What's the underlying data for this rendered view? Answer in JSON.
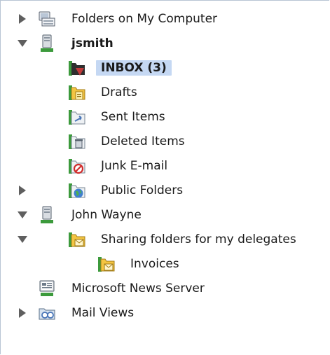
{
  "window": {
    "title": ""
  },
  "tree": {
    "folders_on_computer": "Folders on My Computer",
    "account_jsmith": "jsmith",
    "inbox": "INBOX (3)",
    "drafts": "Drafts",
    "sent": "Sent Items",
    "deleted": "Deleted Items",
    "junk": "Junk E-mail",
    "public": "Public Folders",
    "account_john": "John Wayne",
    "sharing": "Sharing folders for my delegates",
    "invoices": "Invoices",
    "news": "Microsoft News Server",
    "mail_views": "Mail Views"
  },
  "colors": {
    "selection": "#c5d8f3",
    "disclosure": "#5f5f5f",
    "folder": "#f4c542",
    "server_green": "#3c9a3c"
  }
}
